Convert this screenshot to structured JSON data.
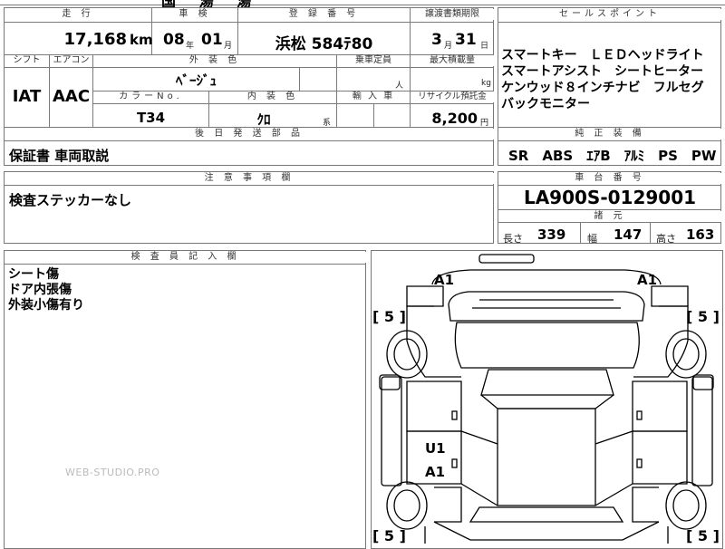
{
  "top_strip": {
    "partial_text": "国 湯 湯"
  },
  "headers": {
    "mileage": "走 行",
    "inspection": "車 検",
    "registration": "登 録 番 号",
    "transfer_deadline": "譲渡書類期限",
    "sales_points": "セールスポイント",
    "shift": "シフト",
    "aircon": "エアコン",
    "exterior_color": "外 装 色",
    "capacity": "乗車定員",
    "max_load": "最大積載量",
    "color_no": "カラーNo.",
    "interior_color": "内 装 色",
    "import": "輸 入 車",
    "recycle": "リサイクル預託金",
    "follow_parts": "後 日 発 送 部 品",
    "genuine_equipment": "純 正 装 備",
    "cautions": "注 意 事 項 欄",
    "chassis_no": "車 台 番 号",
    "specs": "諸 元",
    "inspector_notes": "検 査 員 記 入 欄"
  },
  "vehicle": {
    "mileage_value": "17,168",
    "mileage_unit": "km",
    "inspection_year": "08",
    "inspection_year_unit": "年",
    "inspection_month": "01",
    "inspection_month_unit": "月",
    "registration_number": "浜松 584ﾃ80",
    "transfer_month": "3",
    "transfer_month_unit": "月",
    "transfer_day": "31",
    "transfer_day_unit": "日",
    "shift_value": "IAT",
    "aircon_value": "AAC",
    "exterior_color_value": "ﾍﾞｰｼﾞｭ",
    "capacity_unit": "人",
    "max_load_unit": "kg",
    "color_no_value": "T34",
    "interior_color_value": "ｸﾛ",
    "interior_color_unit": "系",
    "recycle_value": "8,200",
    "recycle_unit": "円"
  },
  "sales_points_lines": [
    "スマートキー　ＬＥＤヘッドライト",
    "スマートアシスト　シートヒーター",
    "ケンウッド８インチナビ　フルセグ",
    "バックモニター"
  ],
  "genuine_equipment_value": "SR　ABS　ｴｱB　ｱﾙﾐ　PS　PW",
  "follow_parts_value": "保証書 車両取説",
  "cautions_value": "検査ステッカーなし",
  "chassis_no_value": "LA900S-0129001",
  "specs": {
    "length_label": "長さ",
    "length_value": "339",
    "width_label": "幅",
    "width_value": "147",
    "height_label": "高さ",
    "height_value": "163"
  },
  "inspector_lines": [
    "シート傷",
    "ドア内張傷",
    "外装小傷有り"
  ],
  "watermark": "WEB-STUDIO.PRO",
  "diagram_marks": {
    "front_left": "A1",
    "front_right": "A1",
    "rear_left_1": "U1",
    "rear_left_2": "A1",
    "tire_fl": "[ 5 ]",
    "tire_fr": "[ 5 ]",
    "tire_rl": "[ 5 ]",
    "tire_rr": "[ 5 ]"
  }
}
